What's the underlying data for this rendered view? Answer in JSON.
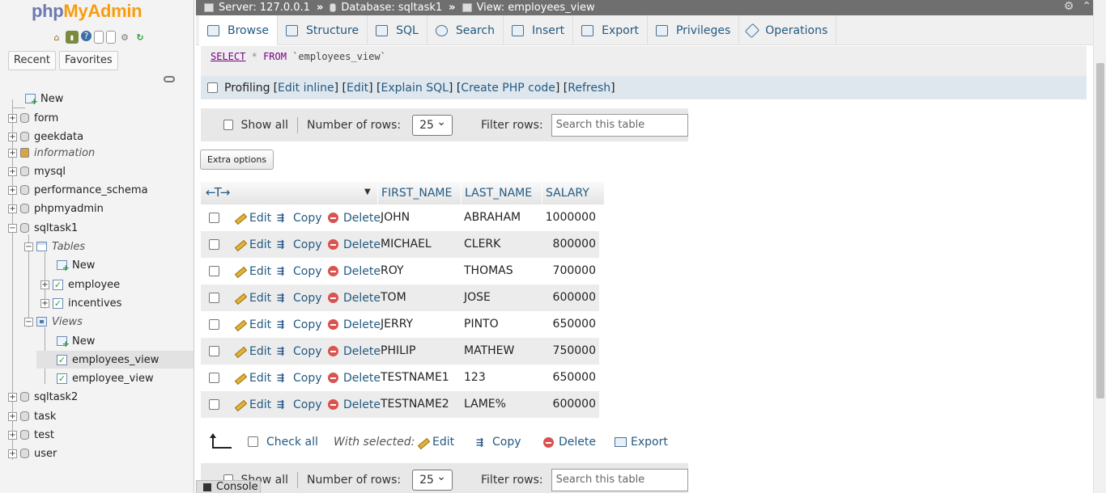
{
  "app": {
    "logo_php": "php",
    "logo_myadmin": "MyAdmin"
  },
  "sidebar": {
    "tabs": [
      "Recent",
      "Favorites"
    ],
    "tree": [
      {
        "label": "New"
      },
      {
        "label": "form"
      },
      {
        "label": "geekdata"
      },
      {
        "label": "information"
      },
      {
        "label": "mysql"
      },
      {
        "label": "performance_schema"
      },
      {
        "label": "phpmyadmin"
      },
      {
        "label": "sqltask1"
      },
      {
        "label": "Tables"
      },
      {
        "label": "New"
      },
      {
        "label": "employee"
      },
      {
        "label": "incentives"
      },
      {
        "label": "Views"
      },
      {
        "label": "New"
      },
      {
        "label": "employees_view"
      },
      {
        "label": "employee_view"
      },
      {
        "label": "sqltask2"
      },
      {
        "label": "task"
      },
      {
        "label": "test"
      },
      {
        "label": "user"
      }
    ]
  },
  "breadcrumb": {
    "server": "Server: 127.0.0.1",
    "database": "Database: sqltask1",
    "view": "View: employees_view",
    "sep": "»"
  },
  "menu": [
    "Browse",
    "Structure",
    "SQL",
    "Search",
    "Insert",
    "Export",
    "Privileges",
    "Operations"
  ],
  "sql": {
    "kw": "SELECT",
    "star": "*",
    "from": "FROM",
    "table": "`employees_view`"
  },
  "profiling": {
    "label": "Profiling",
    "links": [
      "Edit inline",
      "Edit",
      "Explain SQL",
      "Create PHP code",
      "Refresh"
    ]
  },
  "nav": {
    "show_all": "Show all",
    "rows_label": "Number of rows:",
    "rows_value": "25",
    "filter_label": "Filter rows:",
    "filter_placeholder": "Search this table"
  },
  "extra_options": "Extra options",
  "table": {
    "columns": [
      "FIRST_NAME",
      "LAST_NAME",
      "SALARY"
    ],
    "actions": {
      "edit": "Edit",
      "copy": "Copy",
      "delete": "Delete"
    },
    "rows": [
      {
        "first": "JOHN",
        "last": "ABRAHAM",
        "salary": "1000000"
      },
      {
        "first": "MICHAEL",
        "last": "CLERK",
        "salary": "800000"
      },
      {
        "first": "ROY",
        "last": "THOMAS",
        "salary": "700000"
      },
      {
        "first": "TOM",
        "last": "JOSE",
        "salary": "600000"
      },
      {
        "first": "JERRY",
        "last": "PINTO",
        "salary": "650000"
      },
      {
        "first": "PHILIP",
        "last": "MATHEW",
        "salary": "750000"
      },
      {
        "first": "TESTNAME1",
        "last": "123",
        "salary": "650000"
      },
      {
        "first": "TESTNAME2",
        "last": "LAME%",
        "salary": "600000"
      }
    ]
  },
  "bulk": {
    "check_all": "Check all",
    "with_selected": "With selected:",
    "edit": "Edit",
    "copy": "Copy",
    "delete": "Delete",
    "export": "Export"
  },
  "console": "Console"
}
